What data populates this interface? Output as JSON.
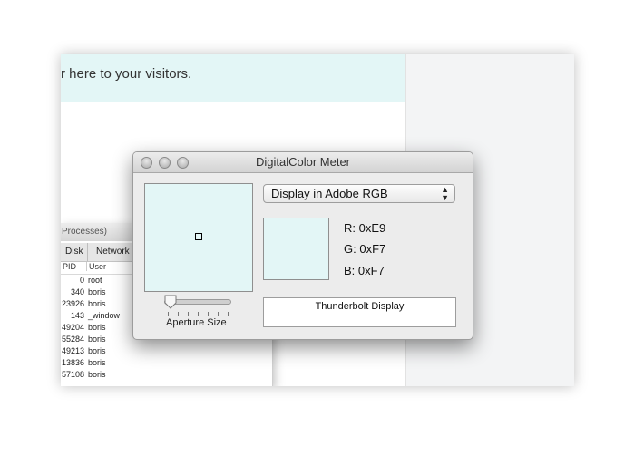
{
  "background": {
    "banner_text": "r here to your visitors.",
    "colors": {
      "banner": "#e3f6f6",
      "right_panel": "#f3f4f5"
    }
  },
  "activity_monitor": {
    "title_fragment": "Processes)",
    "tabs": [
      "Disk",
      "Network"
    ],
    "columns": [
      "PID",
      "User"
    ],
    "rows": [
      {
        "pid": "0",
        "user": "root"
      },
      {
        "pid": "340",
        "user": "boris"
      },
      {
        "pid": "23926",
        "user": "boris"
      },
      {
        "pid": "143",
        "user": "_window"
      },
      {
        "pid": "49204",
        "user": "boris"
      },
      {
        "pid": "55284",
        "user": "boris"
      },
      {
        "pid": "49213",
        "user": "boris"
      },
      {
        "pid": "13836",
        "user": "boris"
      },
      {
        "pid": "57108",
        "user": "boris"
      }
    ]
  },
  "dcm": {
    "title": "DigitalColor Meter",
    "display_mode": "Display in Adobe RGB",
    "r": {
      "label": "R:",
      "value": "0xE9"
    },
    "g": {
      "label": "G:",
      "value": "0xF7"
    },
    "b": {
      "label": "B:",
      "value": "0xF7"
    },
    "aperture_label": "Aperture Size",
    "aperture_value": 0,
    "display_name": "Thunderbolt Display",
    "sample_color": "#e3f6f6"
  }
}
